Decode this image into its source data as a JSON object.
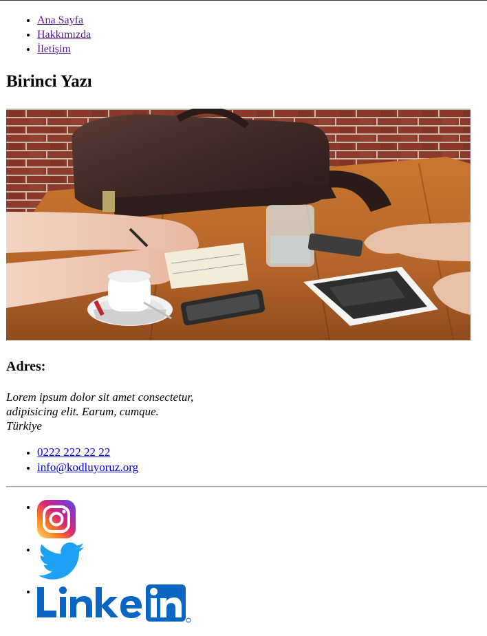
{
  "nav": {
    "items": [
      {
        "label": "Ana Sayfa"
      },
      {
        "label": "Hakkımızda"
      },
      {
        "label": "İletişim"
      }
    ]
  },
  "article": {
    "title": "Birinci Yazı",
    "image_icon": "photo-cafe-table-meeting"
  },
  "address": {
    "heading": "Adres:",
    "line1": "Lorem ipsum dolor sit amet consectetur,",
    "line2": "adipisicing elit. Earum, cumque.",
    "line3": "Türkiye"
  },
  "contact": {
    "phone": "0222 222 22 22",
    "email": "info@kodluyoruz.org"
  },
  "social": {
    "items": [
      {
        "name": "instagram-icon",
        "alt": "Instagram"
      },
      {
        "name": "twitter-icon",
        "alt": "Twitter"
      },
      {
        "name": "linkedin-icon",
        "alt": "LinkedIn"
      }
    ]
  },
  "colors": {
    "visited_link": "#551a8b",
    "link": "#0000ee",
    "instagram_gradient": [
      "#feda75",
      "#fa7e1e",
      "#d62976",
      "#962fbf",
      "#4f5bd5"
    ],
    "twitter": "#1da1f2",
    "linkedin": "#0a66c2"
  }
}
